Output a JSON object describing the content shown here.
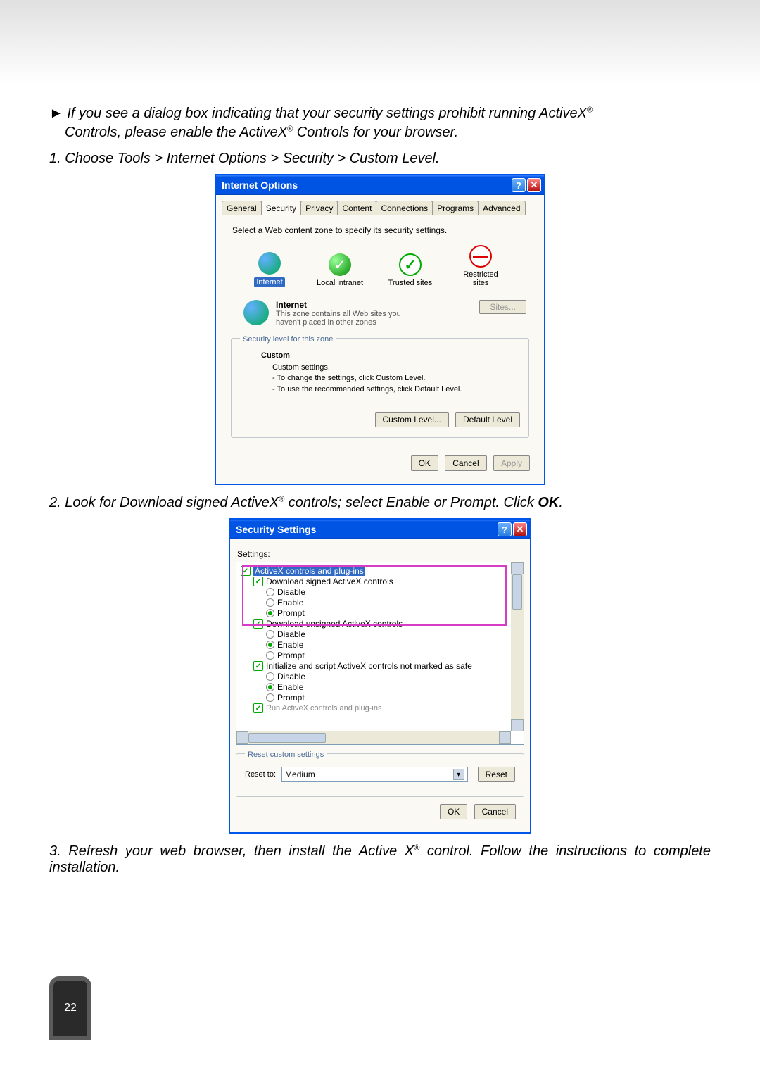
{
  "intro": {
    "arrow": "►",
    "line1": "If you see a dialog box indicating that your security settings prohibit running ActiveX",
    "line2": "Controls, please enable the ActiveX",
    "line2b": " Controls for your browser.",
    "reg": "®"
  },
  "step1": "1. Choose Tools > Internet Options > Security > Custom Level.",
  "step2_a": "2. Look for Download signed ActiveX",
  "step2_b": " controls; select Enable or Prompt. Click ",
  "ok_word": "OK",
  "period": ".",
  "step3_a": "3. Refresh your web browser, then install the Active X",
  "step3_b": " control. Follow the instructions to complete installation.",
  "page_number": "22",
  "dlg1": {
    "title": "Internet Options",
    "tabs": [
      "General",
      "Security",
      "Privacy",
      "Content",
      "Connections",
      "Programs",
      "Advanced"
    ],
    "zone_select_text": "Select a Web content zone to specify its security settings.",
    "zones": {
      "internet": "Internet",
      "local": "Local intranet",
      "trusted": "Trusted sites",
      "restricted": "Restricted sites"
    },
    "zone_heading": "Internet",
    "zone_desc_1": "This zone contains all Web sites you",
    "zone_desc_2": "haven't placed in other zones",
    "sites_btn": "Sites...",
    "fieldset_legend": "Security level for this zone",
    "level_name": "Custom",
    "level_l1": "Custom settings.",
    "level_l2": "- To change the settings, click Custom Level.",
    "level_l3": "- To use the recommended settings, click Default Level.",
    "custom_level_btn": "Custom Level...",
    "default_level_btn": "Default Level",
    "ok_btn": "OK",
    "cancel_btn": "Cancel",
    "apply_btn": "Apply"
  },
  "dlg2": {
    "title": "Security Settings",
    "settings_label": "Settings:",
    "cat_activex": "ActiveX controls and plug-ins",
    "item_dl_signed": "Download signed ActiveX controls",
    "item_dl_unsigned": "Download unsigned ActiveX controls",
    "item_init": "Initialize and script ActiveX controls not marked as safe",
    "opt_disable": "Disable",
    "opt_enable": "Enable",
    "opt_prompt": "Prompt",
    "cut_line": "Run ActiveX controls and plug-ins",
    "fieldset_legend": "Reset custom settings",
    "reset_to_label": "Reset to:",
    "reset_value": "Medium",
    "reset_btn": "Reset",
    "ok_btn": "OK",
    "cancel_btn": "Cancel"
  }
}
